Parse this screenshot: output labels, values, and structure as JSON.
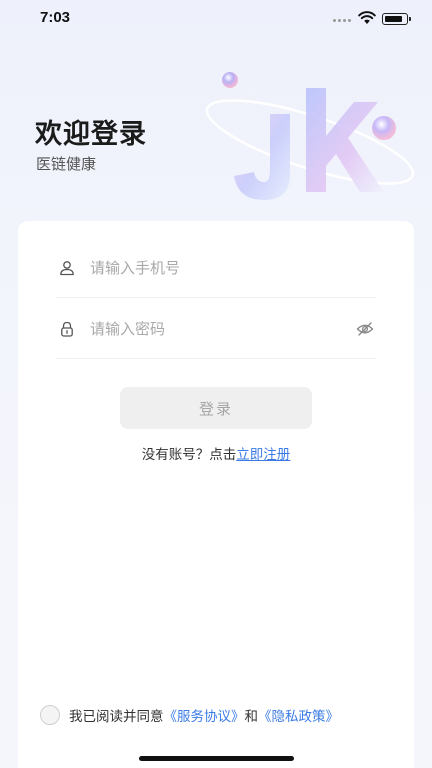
{
  "status_bar": {
    "time": "7:03"
  },
  "header": {
    "title": "欢迎登录",
    "subtitle": "医链健康"
  },
  "form": {
    "phone_placeholder": "请输入手机号",
    "password_placeholder": "请输入密码",
    "login_label": "登录",
    "no_account_text": "没有账号？点击",
    "register_link": "立即注册"
  },
  "agreement": {
    "text_prefix": "我已阅读并同意",
    "service_link": "《服务协议》",
    "conjunction": "和",
    "privacy_link": "《隐私政策》",
    "checked": false
  },
  "colors": {
    "link": "#3a7be6",
    "button_disabled": "#efefef"
  },
  "icons": [
    "wifi-icon",
    "battery-icon",
    "user-icon",
    "lock-icon",
    "eye-hidden-icon"
  ]
}
